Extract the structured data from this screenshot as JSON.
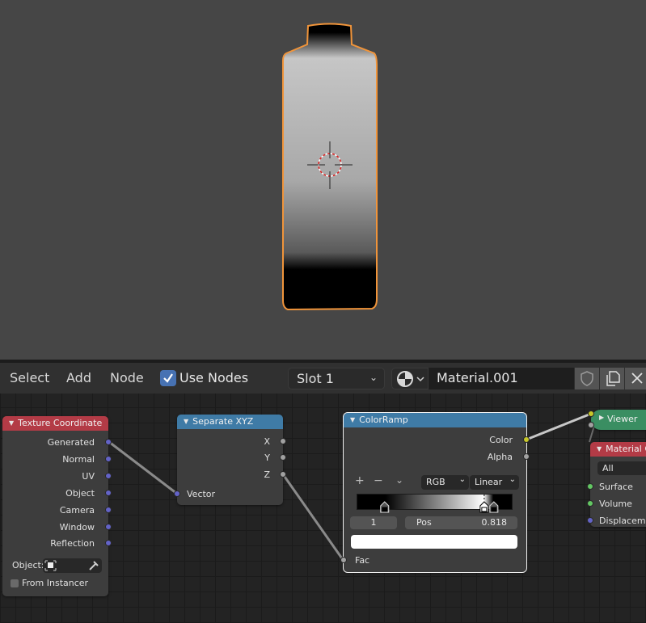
{
  "header": {
    "menus": [
      "Select",
      "Add",
      "Node"
    ],
    "use_nodes_label": "Use Nodes",
    "use_nodes_checked": true,
    "slot_value": "Slot 1",
    "material_name": "Material.001",
    "icons": [
      "material-browse-icon",
      "fake-user-shield-icon",
      "duplicate-icon",
      "close-icon"
    ]
  },
  "nodes": {
    "texcoord": {
      "title": "Texture Coordinate",
      "outputs": [
        "Generated",
        "Normal",
        "UV",
        "Object",
        "Camera",
        "Window",
        "Reflection"
      ],
      "object_label": "Object:",
      "from_instancer_label": "From Instancer",
      "from_instancer_checked": false
    },
    "sepxyz": {
      "title": "Separate XYZ",
      "outputs": [
        "X",
        "Y",
        "Z"
      ],
      "inputs": [
        "Vector"
      ]
    },
    "colorramp": {
      "title": "ColorRamp",
      "outputs": [
        "Color",
        "Alpha"
      ],
      "inputs": [
        "Fac"
      ],
      "color_mode": "RGB",
      "interpolation": "Linear",
      "active_index": "1",
      "pos_label": "Pos",
      "pos_value": "0.818",
      "stops": [
        0.18,
        0.818,
        0.88
      ],
      "active_color": "#ffffff"
    },
    "viewer": {
      "title": "Viewer"
    },
    "matout": {
      "title": "Material Output",
      "target": "All",
      "inputs": [
        "Surface",
        "Volume",
        "Displacement"
      ]
    }
  },
  "colors": {
    "selection_outline": "#f0943a",
    "accent": "#4772b3"
  }
}
